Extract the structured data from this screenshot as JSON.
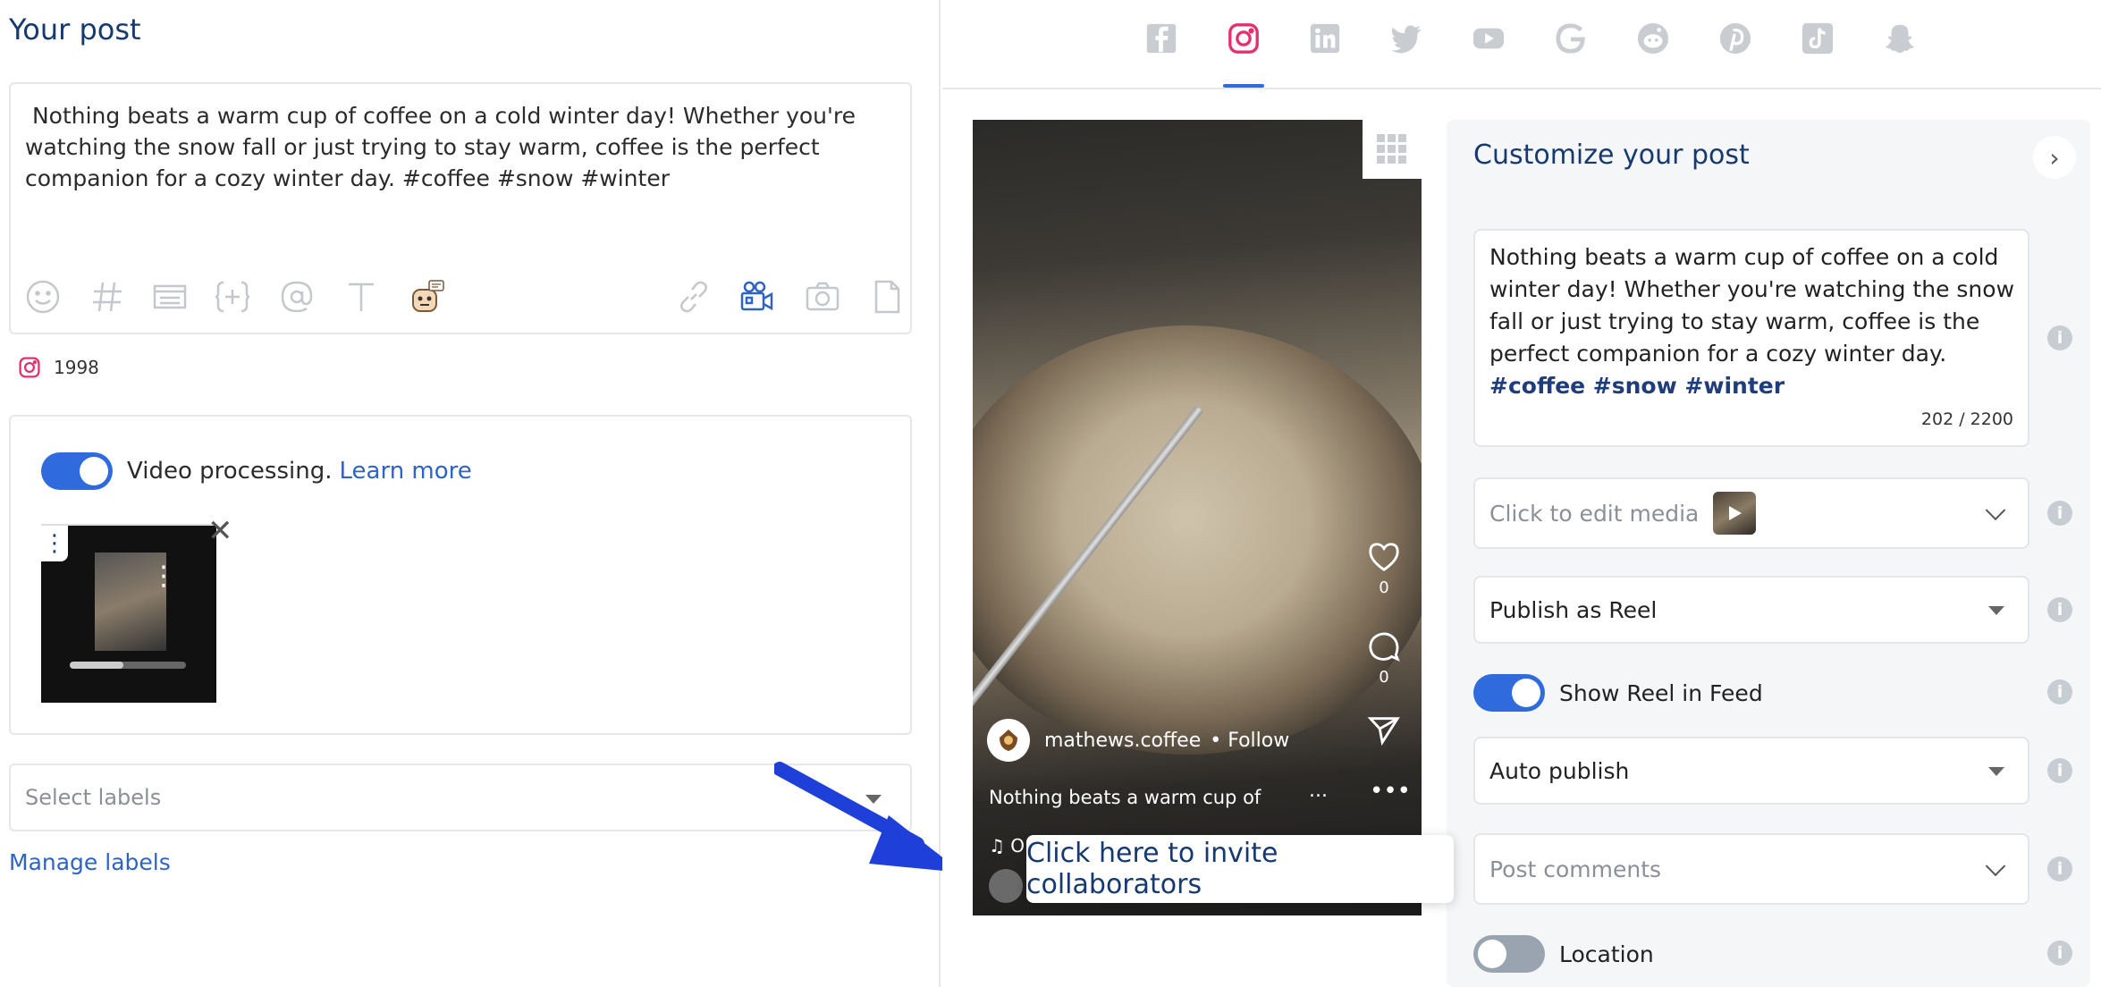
{
  "left": {
    "title": "Your post",
    "post_text": " Nothing beats a warm cup of coffee on a cold winter day! Whether you're watching the snow fall or just trying to stay warm, coffee is the perfect companion for a cozy winter day. #coffee #snow #winter",
    "toolbar_icons": [
      "emoji-icon",
      "hashtag-icon",
      "text-block-icon",
      "variable-icon",
      "mention-icon",
      "font-icon",
      "ai-assistant-icon",
      "link-icon",
      "video-icon",
      "camera-icon",
      "document-icon"
    ],
    "char_count": "1998",
    "video_processing": {
      "label": "Video processing.",
      "link": "Learn more",
      "enabled": true
    },
    "labels": {
      "placeholder": "Select labels",
      "manage_link": "Manage labels"
    }
  },
  "right": {
    "social_tabs": [
      "facebook-icon",
      "instagram-icon",
      "linkedin-icon",
      "twitter-icon",
      "youtube-icon",
      "google-icon",
      "reddit-icon",
      "pinterest-icon",
      "tiktok-icon",
      "snapchat-icon"
    ],
    "active_tab": "instagram-icon",
    "preview": {
      "likes": "0",
      "comments": "0",
      "account": "mathews.coffee",
      "follow": "• Follow",
      "caption": "Nothing beats a warm cup of",
      "more": "...",
      "menu": "•••",
      "music": "♫ O"
    },
    "tooltip": "Click here to invite collaborators",
    "customize": {
      "title": "Customize your post",
      "caption_line1": "Nothing beats a warm cup of coffee on a cold winter day! Whether you're watching the snow fall or just trying to stay warm, coffee is the perfect companion for a cozy winter day.",
      "caption_tags": "#coffee #snow #winter",
      "counter": "202 / 2200",
      "edit_media": "Click to edit media",
      "publish_as": "Publish as Reel",
      "show_reel_label": "Show Reel in Feed",
      "show_reel_enabled": true,
      "publish_mode": "Auto publish",
      "post_comments": "Post comments",
      "location_label": "Location",
      "location_enabled": false
    }
  },
  "colors": {
    "accent": "#2f6bdc",
    "title_navy": "#163a70",
    "link": "#2f63c4",
    "instagram": "#e1306c",
    "arrow": "#1f3fd9"
  }
}
